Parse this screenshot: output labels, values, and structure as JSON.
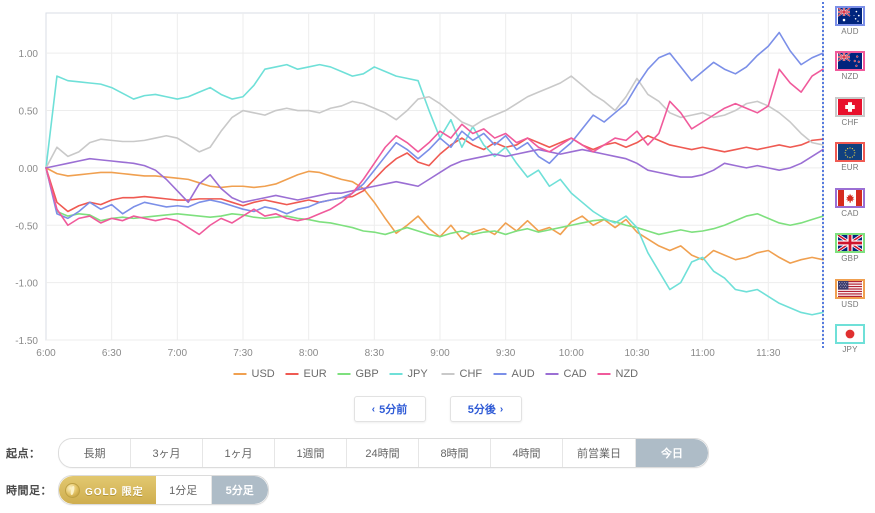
{
  "chart_data": {
    "type": "line",
    "title": "",
    "xlabel": "",
    "ylabel": "",
    "ylim": [
      -1.5,
      1.35
    ],
    "yticks": [
      1.0,
      0.5,
      0.0,
      -0.5,
      -1.0,
      -1.5
    ],
    "ytick_labels": [
      "1.00",
      "0.50",
      "0.00",
      "-0.50",
      "-1.00",
      "-1.50"
    ],
    "xticks": [
      "6:00",
      "6:30",
      "7:00",
      "7:30",
      "8:00",
      "8:30",
      "9:00",
      "9:30",
      "10:00",
      "10:30",
      "11:00",
      "11:30"
    ],
    "x_start": "6:00",
    "x_end": "11:55",
    "x_step_minutes": 5,
    "grid": true,
    "legend_position": "bottom",
    "series": [
      {
        "name": "USD",
        "color": "#f0a050",
        "values": [
          0.0,
          -0.05,
          -0.07,
          -0.06,
          -0.05,
          -0.04,
          -0.04,
          -0.05,
          -0.06,
          -0.07,
          -0.07,
          -0.08,
          -0.09,
          -0.1,
          -0.13,
          -0.16,
          -0.17,
          -0.16,
          -0.16,
          -0.17,
          -0.16,
          -0.14,
          -0.1,
          -0.06,
          -0.03,
          -0.04,
          -0.07,
          -0.1,
          -0.12,
          -0.18,
          -0.3,
          -0.44,
          -0.57,
          -0.5,
          -0.42,
          -0.53,
          -0.6,
          -0.5,
          -0.62,
          -0.56,
          -0.53,
          -0.58,
          -0.48,
          -0.55,
          -0.46,
          -0.55,
          -0.52,
          -0.58,
          -0.47,
          -0.42,
          -0.5,
          -0.45,
          -0.52,
          -0.45,
          -0.56,
          -0.62,
          -0.68,
          -0.72,
          -0.68,
          -0.76,
          -0.8,
          -0.72,
          -0.76,
          -0.8,
          -0.78,
          -0.74,
          -0.72,
          -0.78,
          -0.83,
          -0.8,
          -0.78,
          -0.8
        ]
      },
      {
        "name": "EUR",
        "color": "#ef5a52",
        "values": [
          0.0,
          -0.3,
          -0.38,
          -0.33,
          -0.3,
          -0.32,
          -0.28,
          -0.26,
          -0.26,
          -0.25,
          -0.26,
          -0.27,
          -0.28,
          -0.28,
          -0.27,
          -0.27,
          -0.27,
          -0.3,
          -0.33,
          -0.3,
          -0.28,
          -0.3,
          -0.32,
          -0.3,
          -0.28,
          -0.3,
          -0.28,
          -0.26,
          -0.25,
          -0.2,
          -0.1,
          0.0,
          0.08,
          0.13,
          0.05,
          0.02,
          0.12,
          0.2,
          0.26,
          0.2,
          0.16,
          0.22,
          0.18,
          0.2,
          0.26,
          0.22,
          0.18,
          0.22,
          0.26,
          0.2,
          0.16,
          0.2,
          0.22,
          0.18,
          0.22,
          0.28,
          0.24,
          0.2,
          0.18,
          0.16,
          0.18,
          0.16,
          0.14,
          0.16,
          0.18,
          0.16,
          0.18,
          0.2,
          0.18,
          0.2,
          0.24,
          0.25
        ]
      },
      {
        "name": "GBP",
        "color": "#7ee07e",
        "values": [
          0.0,
          -0.38,
          -0.42,
          -0.4,
          -0.41,
          -0.46,
          -0.44,
          -0.43,
          -0.44,
          -0.43,
          -0.42,
          -0.41,
          -0.4,
          -0.41,
          -0.42,
          -0.43,
          -0.42,
          -0.4,
          -0.41,
          -0.43,
          -0.44,
          -0.43,
          -0.42,
          -0.44,
          -0.45,
          -0.47,
          -0.48,
          -0.5,
          -0.52,
          -0.55,
          -0.56,
          -0.58,
          -0.55,
          -0.52,
          -0.55,
          -0.58,
          -0.6,
          -0.57,
          -0.55,
          -0.58,
          -0.56,
          -0.55,
          -0.58,
          -0.55,
          -0.53,
          -0.56,
          -0.54,
          -0.52,
          -0.5,
          -0.48,
          -0.46,
          -0.45,
          -0.47,
          -0.5,
          -0.52,
          -0.55,
          -0.58,
          -0.56,
          -0.54,
          -0.56,
          -0.55,
          -0.53,
          -0.5,
          -0.46,
          -0.42,
          -0.4,
          -0.44,
          -0.48,
          -0.5,
          -0.48,
          -0.45,
          -0.42
        ]
      },
      {
        "name": "JPY",
        "color": "#6fe0d8",
        "values": [
          0.0,
          0.8,
          0.76,
          0.75,
          0.74,
          0.73,
          0.7,
          0.65,
          0.6,
          0.63,
          0.64,
          0.62,
          0.6,
          0.62,
          0.66,
          0.7,
          0.64,
          0.6,
          0.62,
          0.72,
          0.86,
          0.88,
          0.9,
          0.86,
          0.88,
          0.9,
          0.88,
          0.84,
          0.8,
          0.82,
          0.88,
          0.84,
          0.8,
          0.78,
          0.76,
          0.5,
          0.26,
          0.42,
          0.18,
          0.36,
          0.2,
          0.1,
          0.18,
          0.04,
          -0.08,
          -0.02,
          -0.16,
          -0.1,
          -0.22,
          -0.3,
          -0.38,
          -0.44,
          -0.48,
          -0.42,
          -0.52,
          -0.74,
          -0.9,
          -1.06,
          -1.0,
          -0.82,
          -0.78,
          -0.9,
          -0.96,
          -1.06,
          -1.08,
          -1.06,
          -1.12,
          -1.18,
          -1.22,
          -1.26,
          -1.28,
          -1.26
        ]
      },
      {
        "name": "CHF",
        "color": "#c9c9c9",
        "values": [
          0.0,
          0.18,
          0.1,
          0.14,
          0.22,
          0.25,
          0.24,
          0.23,
          0.23,
          0.24,
          0.26,
          0.28,
          0.26,
          0.2,
          0.14,
          0.18,
          0.32,
          0.44,
          0.5,
          0.48,
          0.46,
          0.5,
          0.52,
          0.5,
          0.5,
          0.48,
          0.52,
          0.54,
          0.58,
          0.56,
          0.52,
          0.48,
          0.42,
          0.5,
          0.6,
          0.62,
          0.56,
          0.48,
          0.4,
          0.36,
          0.42,
          0.46,
          0.5,
          0.56,
          0.62,
          0.66,
          0.7,
          0.74,
          0.8,
          0.72,
          0.64,
          0.58,
          0.5,
          0.62,
          0.78,
          0.64,
          0.58,
          0.48,
          0.44,
          0.46,
          0.48,
          0.44,
          0.46,
          0.5,
          0.56,
          0.58,
          0.54,
          0.48,
          0.4,
          0.3,
          0.22,
          0.2
        ]
      },
      {
        "name": "AUD",
        "color": "#7b8fe8",
        "values": [
          0.0,
          -0.4,
          -0.44,
          -0.38,
          -0.3,
          -0.36,
          -0.32,
          -0.4,
          -0.34,
          -0.3,
          -0.32,
          -0.34,
          -0.33,
          -0.34,
          -0.3,
          -0.28,
          -0.3,
          -0.33,
          -0.36,
          -0.38,
          -0.34,
          -0.36,
          -0.4,
          -0.36,
          -0.34,
          -0.3,
          -0.28,
          -0.26,
          -0.22,
          -0.14,
          -0.02,
          0.1,
          0.22,
          0.16,
          0.08,
          0.16,
          0.26,
          0.18,
          0.32,
          0.24,
          0.3,
          0.2,
          0.28,
          0.16,
          0.22,
          0.1,
          0.04,
          0.14,
          0.22,
          0.34,
          0.46,
          0.4,
          0.48,
          0.56,
          0.72,
          0.86,
          0.96,
          1.0,
          0.88,
          0.76,
          0.84,
          0.92,
          0.86,
          0.82,
          0.88,
          0.98,
          1.06,
          1.18,
          1.02,
          0.9,
          0.96,
          1.0
        ]
      },
      {
        "name": "CAD",
        "color": "#9b6fd4",
        "values": [
          0.0,
          0.02,
          0.04,
          0.06,
          0.08,
          0.07,
          0.06,
          0.05,
          0.04,
          0.02,
          -0.02,
          -0.1,
          -0.2,
          -0.3,
          -0.14,
          -0.06,
          -0.18,
          -0.26,
          -0.3,
          -0.28,
          -0.26,
          -0.24,
          -0.26,
          -0.28,
          -0.26,
          -0.24,
          -0.22,
          -0.22,
          -0.2,
          -0.18,
          -0.16,
          -0.14,
          -0.12,
          -0.14,
          -0.16,
          -0.1,
          -0.04,
          0.02,
          0.06,
          0.08,
          0.1,
          0.12,
          0.1,
          0.12,
          0.14,
          0.16,
          0.14,
          0.12,
          0.14,
          0.16,
          0.14,
          0.12,
          0.1,
          0.08,
          0.04,
          -0.02,
          -0.04,
          -0.06,
          -0.08,
          -0.08,
          -0.06,
          -0.02,
          0.04,
          0.02,
          0.0,
          0.02,
          0.0,
          -0.02,
          0.0,
          0.04,
          0.1,
          0.16
        ]
      },
      {
        "name": "NZD",
        "color": "#f05a9b",
        "values": [
          0.0,
          -0.36,
          -0.5,
          -0.44,
          -0.42,
          -0.48,
          -0.44,
          -0.46,
          -0.42,
          -0.44,
          -0.46,
          -0.44,
          -0.46,
          -0.52,
          -0.58,
          -0.5,
          -0.44,
          -0.48,
          -0.42,
          -0.36,
          -0.42,
          -0.4,
          -0.44,
          -0.46,
          -0.44,
          -0.4,
          -0.36,
          -0.3,
          -0.22,
          -0.1,
          0.04,
          0.18,
          0.28,
          0.22,
          0.14,
          0.22,
          0.32,
          0.26,
          0.38,
          0.3,
          0.34,
          0.26,
          0.3,
          0.22,
          0.26,
          0.18,
          0.14,
          0.2,
          0.26,
          0.2,
          0.14,
          0.2,
          0.26,
          0.24,
          0.32,
          0.2,
          0.3,
          0.58,
          0.48,
          0.34,
          0.4,
          0.46,
          0.52,
          0.56,
          0.52,
          0.48,
          0.54,
          0.86,
          0.74,
          0.66,
          0.8,
          0.86
        ]
      }
    ]
  },
  "flags": [
    {
      "code": "AUD",
      "border": "#7b8fe8"
    },
    {
      "code": "NZD",
      "border": "#f05a9b"
    },
    {
      "code": "CHF",
      "border": "#c9c9c9"
    },
    {
      "code": "EUR",
      "border": "#ef5a52"
    },
    {
      "code": "CAD",
      "border": "#9b6fd4"
    },
    {
      "code": "GBP",
      "border": "#7ee07e"
    },
    {
      "code": "USD",
      "border": "#f0a050"
    },
    {
      "code": "JPY",
      "border": "#6fe0d8"
    }
  ],
  "nav": {
    "prev_label": "5分前",
    "prev_chevron": "‹",
    "next_label": "5分後",
    "next_chevron": "›"
  },
  "origin_row": {
    "label": "起点：",
    "options": [
      {
        "label": "長期",
        "active": false
      },
      {
        "label": "3ヶ月",
        "active": false
      },
      {
        "label": "1ヶ月",
        "active": false
      },
      {
        "label": "1週間",
        "active": false
      },
      {
        "label": "24時間",
        "active": false
      },
      {
        "label": "8時間",
        "active": false
      },
      {
        "label": "4時間",
        "active": false
      },
      {
        "label": "前営業日",
        "active": false
      },
      {
        "label": "今日",
        "active": true
      }
    ]
  },
  "timeframe_row": {
    "label": "時間足：",
    "gold_badge": "GOLD 限定",
    "options": [
      {
        "label": "1分足",
        "active": false
      },
      {
        "label": "5分足",
        "active": true
      }
    ]
  },
  "colors": {
    "accent_link": "#2f5bd6",
    "active_tab_bg": "#aebcc7",
    "grid": "#ededed",
    "axis_text": "#8a8a8a",
    "plot_border": "#d8dde6",
    "marker_line": "#2f5bd6"
  }
}
